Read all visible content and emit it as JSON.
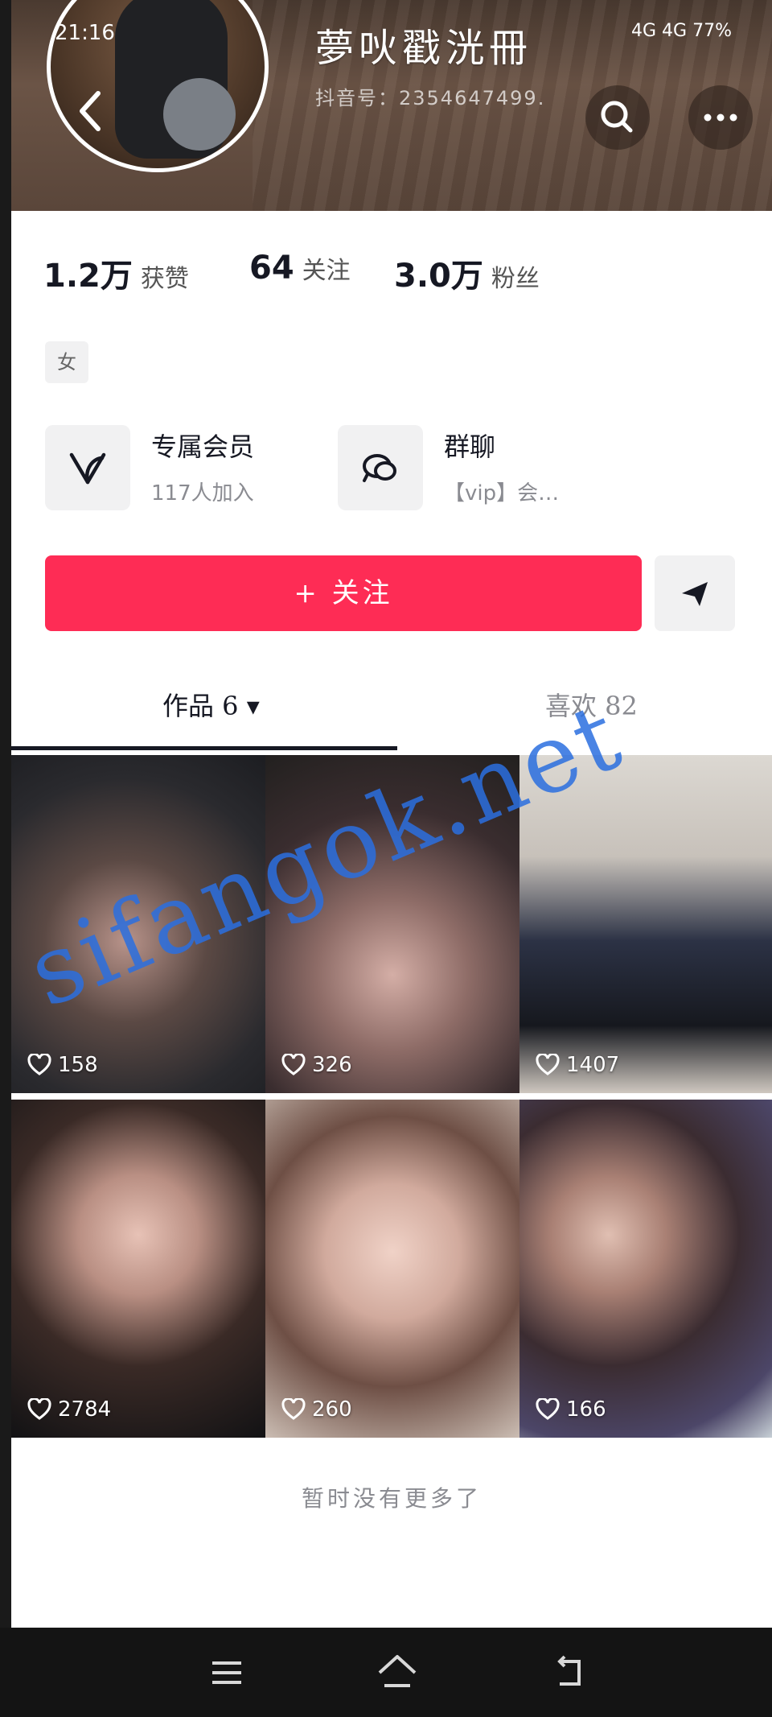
{
  "status_bar": {
    "time": "21:16",
    "right": "4G 4G 77%"
  },
  "profile": {
    "nickname": "夢吙戳洸冊",
    "account_id": "抖音号：2354647499."
  },
  "stats": {
    "likes_value": "1.2万",
    "likes_label": "获赞",
    "following_value": "64",
    "following_label": "关注",
    "followers_value": "3.0万",
    "followers_label": "粉丝"
  },
  "gender_tag": "女",
  "entries": {
    "member_title": "专属会员",
    "member_sub": "117人加入",
    "group_title": "群聊",
    "group_sub": "【vip】会…"
  },
  "actions": {
    "follow_label": "+ 关注"
  },
  "tabs": {
    "works": "作品 6 ▾",
    "likes": "喜欢 82"
  },
  "videos": [
    {
      "likes": "158"
    },
    {
      "likes": "326"
    },
    {
      "likes": "1407"
    },
    {
      "likes": "2784"
    },
    {
      "likes": "260"
    },
    {
      "likes": "166"
    }
  ],
  "footer_text": "暂时没有更多了",
  "watermark": "sifangok.net",
  "colors": {
    "accent": "#fe2c55",
    "watermark": "#2b6fe0",
    "navbar": "#141414"
  },
  "icons": [
    "back-icon",
    "search-icon",
    "more-icon",
    "member-heart-icon",
    "group-chat-icon",
    "share-icon",
    "heart-icon",
    "menu-icon",
    "home-icon",
    "return-icon"
  ]
}
